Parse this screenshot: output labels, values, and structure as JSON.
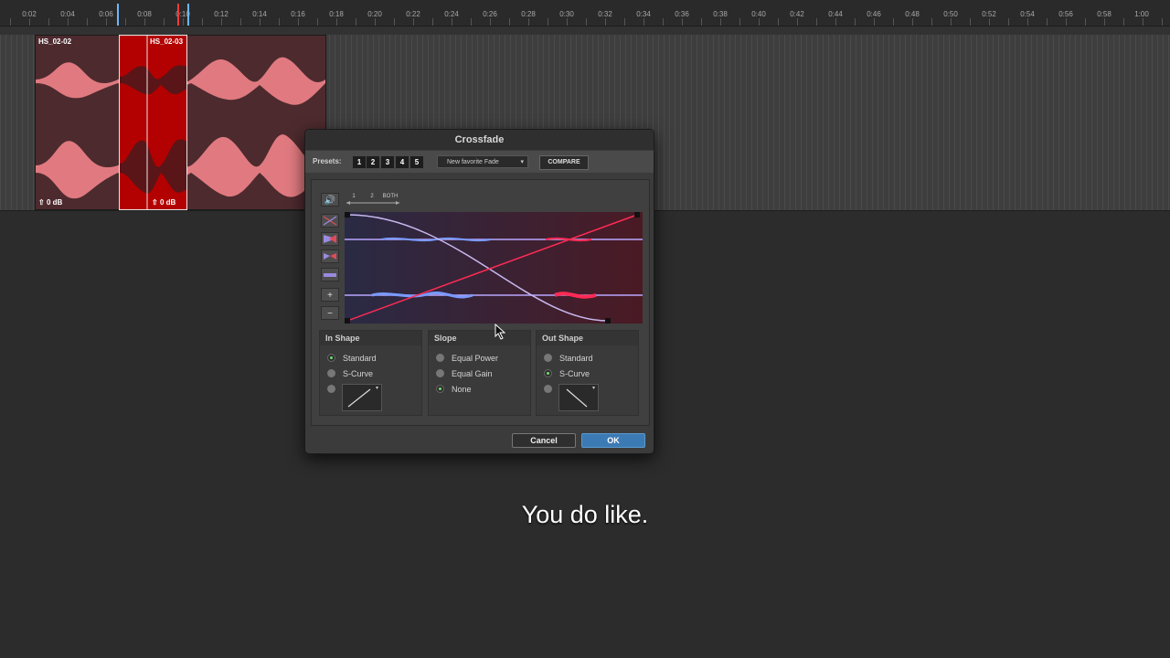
{
  "ruler": {
    "ticks": [
      "0:02",
      "0:04",
      "0:06",
      "0:08",
      "0:10",
      "0:12",
      "0:14",
      "0:16",
      "0:18",
      "0:20",
      "0:22",
      "0:24",
      "0:26",
      "0:28",
      "0:30",
      "0:32",
      "0:34",
      "0:36",
      "0:38",
      "0:40",
      "0:42",
      "0:44",
      "0:46",
      "0:48",
      "0:50",
      "0:52",
      "0:54",
      "0:56",
      "0:58",
      "1:00"
    ]
  },
  "clips": {
    "clip1": {
      "name": "HS_02-02",
      "gain": "0 dB"
    },
    "clip2": {
      "name": "HS_02-03",
      "gain": "0 dB"
    }
  },
  "dialog": {
    "title": "Crossfade",
    "presets_label": "Presets:",
    "preset_buttons": [
      "1",
      "2",
      "3",
      "4",
      "5"
    ],
    "favorite_select": "New favorite Fade",
    "compare_label": "COMPARE",
    "link_buttons": [
      "1",
      "2",
      "BOTH"
    ],
    "in_shape": {
      "title": "In Shape",
      "options": [
        "Standard",
        "S-Curve"
      ],
      "selected": "Standard"
    },
    "slope": {
      "title": "Slope",
      "options": [
        "Equal Power",
        "Equal Gain",
        "None"
      ],
      "selected": "None"
    },
    "out_shape": {
      "title": "Out Shape",
      "options": [
        "Standard",
        "S-Curve"
      ],
      "selected": "S-Curve"
    },
    "cancel_label": "Cancel",
    "ok_label": "OK"
  },
  "subtitle": "You do like.",
  "colors": {
    "accent_blue": "#3c7ab3",
    "fade_in_curve": "#ff2b55",
    "fade_out_curve": "#b9a6ff",
    "clip_waveform": "#e07a80",
    "crossfade_region": "#b30000"
  }
}
